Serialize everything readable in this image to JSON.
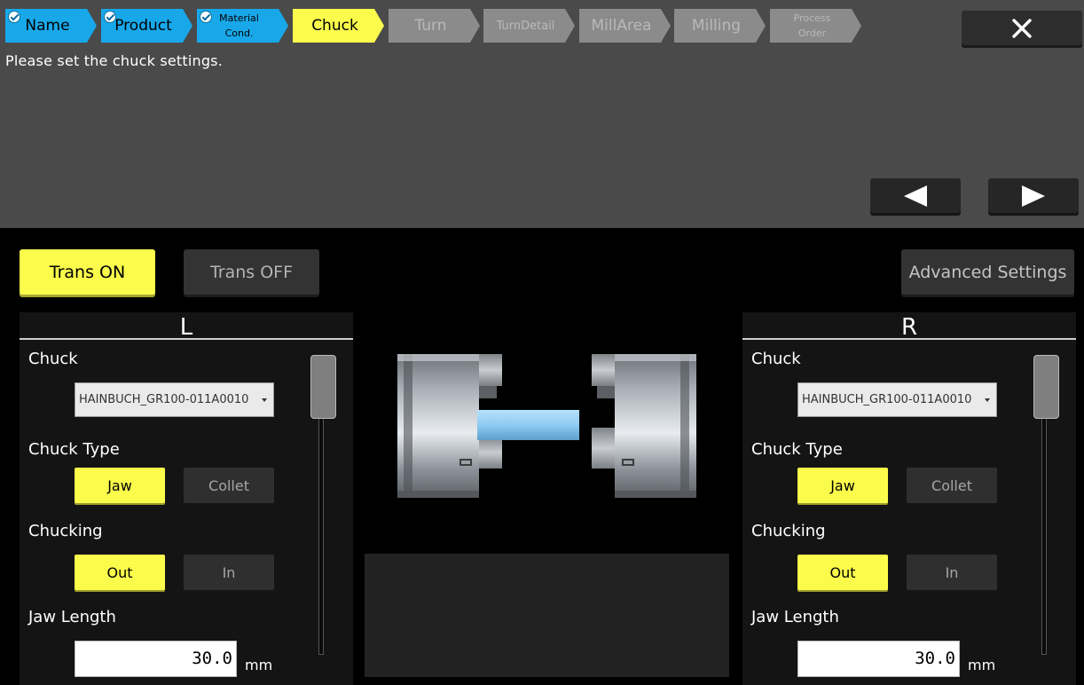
{
  "wizard": {
    "steps": [
      {
        "label": "Name",
        "state": "done"
      },
      {
        "label": "Product",
        "state": "done"
      },
      {
        "label": "Material Cond.",
        "line1": "Material",
        "line2": "Cond.",
        "state": "done"
      },
      {
        "label": "Chuck",
        "state": "current"
      },
      {
        "label": "Turn",
        "state": "todo"
      },
      {
        "label": "TurnDetail",
        "state": "todo"
      },
      {
        "label": "MillArea",
        "state": "todo"
      },
      {
        "label": "Milling",
        "state": "todo"
      },
      {
        "label": "Process Order",
        "line1": "Process",
        "line2": "Order",
        "state": "todo"
      }
    ],
    "close_icon": "close-icon"
  },
  "instruction": "Please set the chuck settings.",
  "nav": {
    "prev_icon": "triangle-left-icon",
    "next_icon": "triangle-right-icon"
  },
  "toolbar": {
    "trans_on": "Trans ON",
    "trans_off": "Trans OFF",
    "advanced": "Advanced Settings",
    "trans_selected": "Trans ON"
  },
  "left": {
    "title": "L",
    "chuck_label": "Chuck",
    "chuck_value": "HAINBUCH_GR100-011A0010",
    "chuck_type_label": "Chuck Type",
    "chuck_type_options": [
      "Jaw",
      "Collet"
    ],
    "chuck_type_selected": "Jaw",
    "chucking_label": "Chucking",
    "chucking_options": [
      "Out",
      "In"
    ],
    "chucking_selected": "Out",
    "jaw_length_label": "Jaw Length",
    "jaw_length_value": "30.0",
    "jaw_length_unit": "mm"
  },
  "right": {
    "title": "R",
    "chuck_label": "Chuck",
    "chuck_value": "HAINBUCH_GR100-011A0010",
    "chuck_type_label": "Chuck Type",
    "chuck_type_options": [
      "Jaw",
      "Collet"
    ],
    "chuck_type_selected": "Jaw",
    "chucking_label": "Chucking",
    "chucking_options": [
      "Out",
      "In"
    ],
    "chucking_selected": "Out",
    "jaw_length_label": "Jaw Length",
    "jaw_length_value": "30.0",
    "jaw_length_unit": "mm"
  },
  "colors": {
    "done": "#18a8ea",
    "current": "#fbfb4c",
    "todo": "#8b8b8b",
    "selected": "#fbfb4c",
    "header_bg": "#4a4a4a",
    "workpiece": "#8fcbf2"
  }
}
